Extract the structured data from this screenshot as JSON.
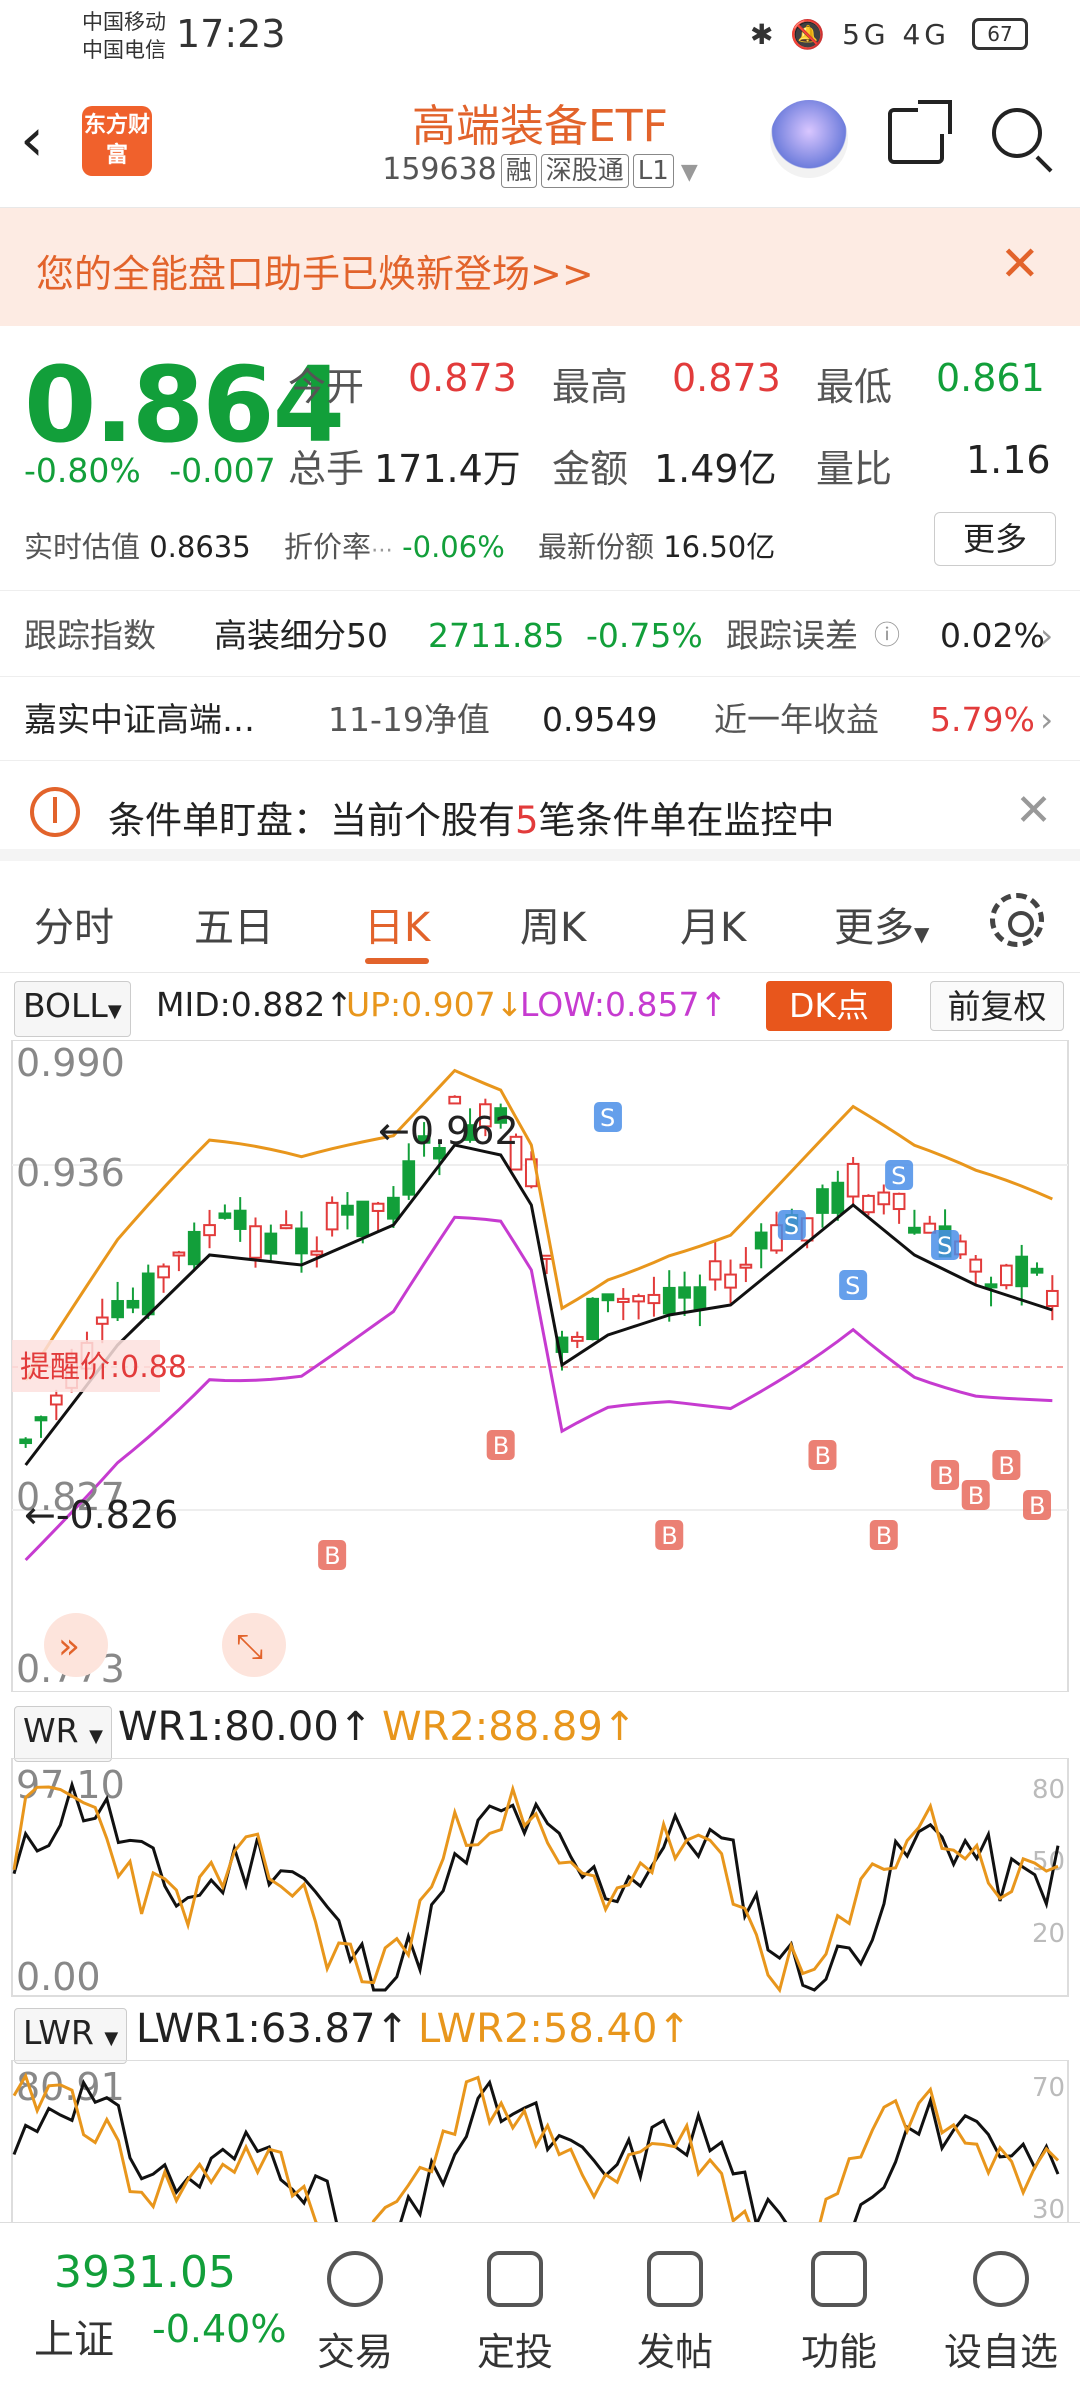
{
  "status_bar": {
    "carrier1": "中国移动",
    "carrier2": "中国电信",
    "time": "17:23",
    "icons": "✱ 🔕 5G 4G",
    "battery": "67"
  },
  "header": {
    "logo_text": "东方财富",
    "title": "高端装备ETF",
    "code": "159638",
    "tag1": "融",
    "tag2": "深股通",
    "tag3": "L1"
  },
  "promo": {
    "text": "您的全能盘口助手已焕新登场>>"
  },
  "quote": {
    "price": "0.864",
    "change_pct": "-0.80%",
    "change_abs": "-0.007",
    "open_label": "今开",
    "open": "0.873",
    "high_label": "最高",
    "high": "0.873",
    "low_label": "最低",
    "low": "0.861",
    "volume_label": "总手",
    "volume": "171.4万",
    "amount_label": "金额",
    "amount": "1.49亿",
    "ratio_label": "量比",
    "ratio": "1.16",
    "est_label": "实时估值",
    "est": "0.8635",
    "discount_label": "折价率",
    "discount": "-0.06%",
    "share_label": "最新份额",
    "share": "16.50亿",
    "more": "更多"
  },
  "tracking": {
    "label": "跟踪指数",
    "index": "高装细分50",
    "value": "2711.85",
    "pct": "-0.75%",
    "err_label": "跟踪误差",
    "err": "0.02%"
  },
  "fund": {
    "name": "嘉实中证高端…",
    "nav_label": "11-19净值",
    "nav": "0.9549",
    "ret_label": "近一年收益",
    "ret": "5.79%"
  },
  "alert": {
    "prefix": "条件单盯盘：当前个股有",
    "count": "5",
    "suffix": "笔条件单在监控中"
  },
  "tabs": [
    "分时",
    "五日",
    "日K",
    "周K",
    "月K",
    "更多"
  ],
  "boll": {
    "name": "BOLL",
    "mid": "MID:0.882↑",
    "up": "UP:0.907↓",
    "low": "LOW:0.857↑",
    "dk": "DK点",
    "fq": "前复权"
  },
  "kchart": {
    "y_top": "0.990",
    "y2": "0.936",
    "y3": "0.88",
    "y4": "0.827",
    "y_bot": "0.773",
    "high_mark": "←0.962",
    "low_mark": "←-0.826",
    "remind": "提醒价:0.88"
  },
  "wr": {
    "name": "WR",
    "wr1": "WR1:80.00↑",
    "wr2": "WR2:88.89↑",
    "top": "97.10",
    "bot": "0.00",
    "r80": "80",
    "r50": "50",
    "r20": "20"
  },
  "lwr": {
    "name": "LWR",
    "lwr1": "LWR1:63.87↑",
    "lwr2": "LWR2:58.40↑",
    "top": "80.91",
    "r70": "70",
    "r30": "30"
  },
  "nav": {
    "index_value": "3931.05",
    "index_name": "上证",
    "index_pct": "-0.40%",
    "items": [
      "交易",
      "定投",
      "发帖",
      "功能",
      "设自选"
    ]
  },
  "colors": {
    "accent": "#e2632b",
    "up": "#e23b3b",
    "down": "#129f3a",
    "boll_up": "#e8961c",
    "boll_low": "#c63bd0"
  }
}
